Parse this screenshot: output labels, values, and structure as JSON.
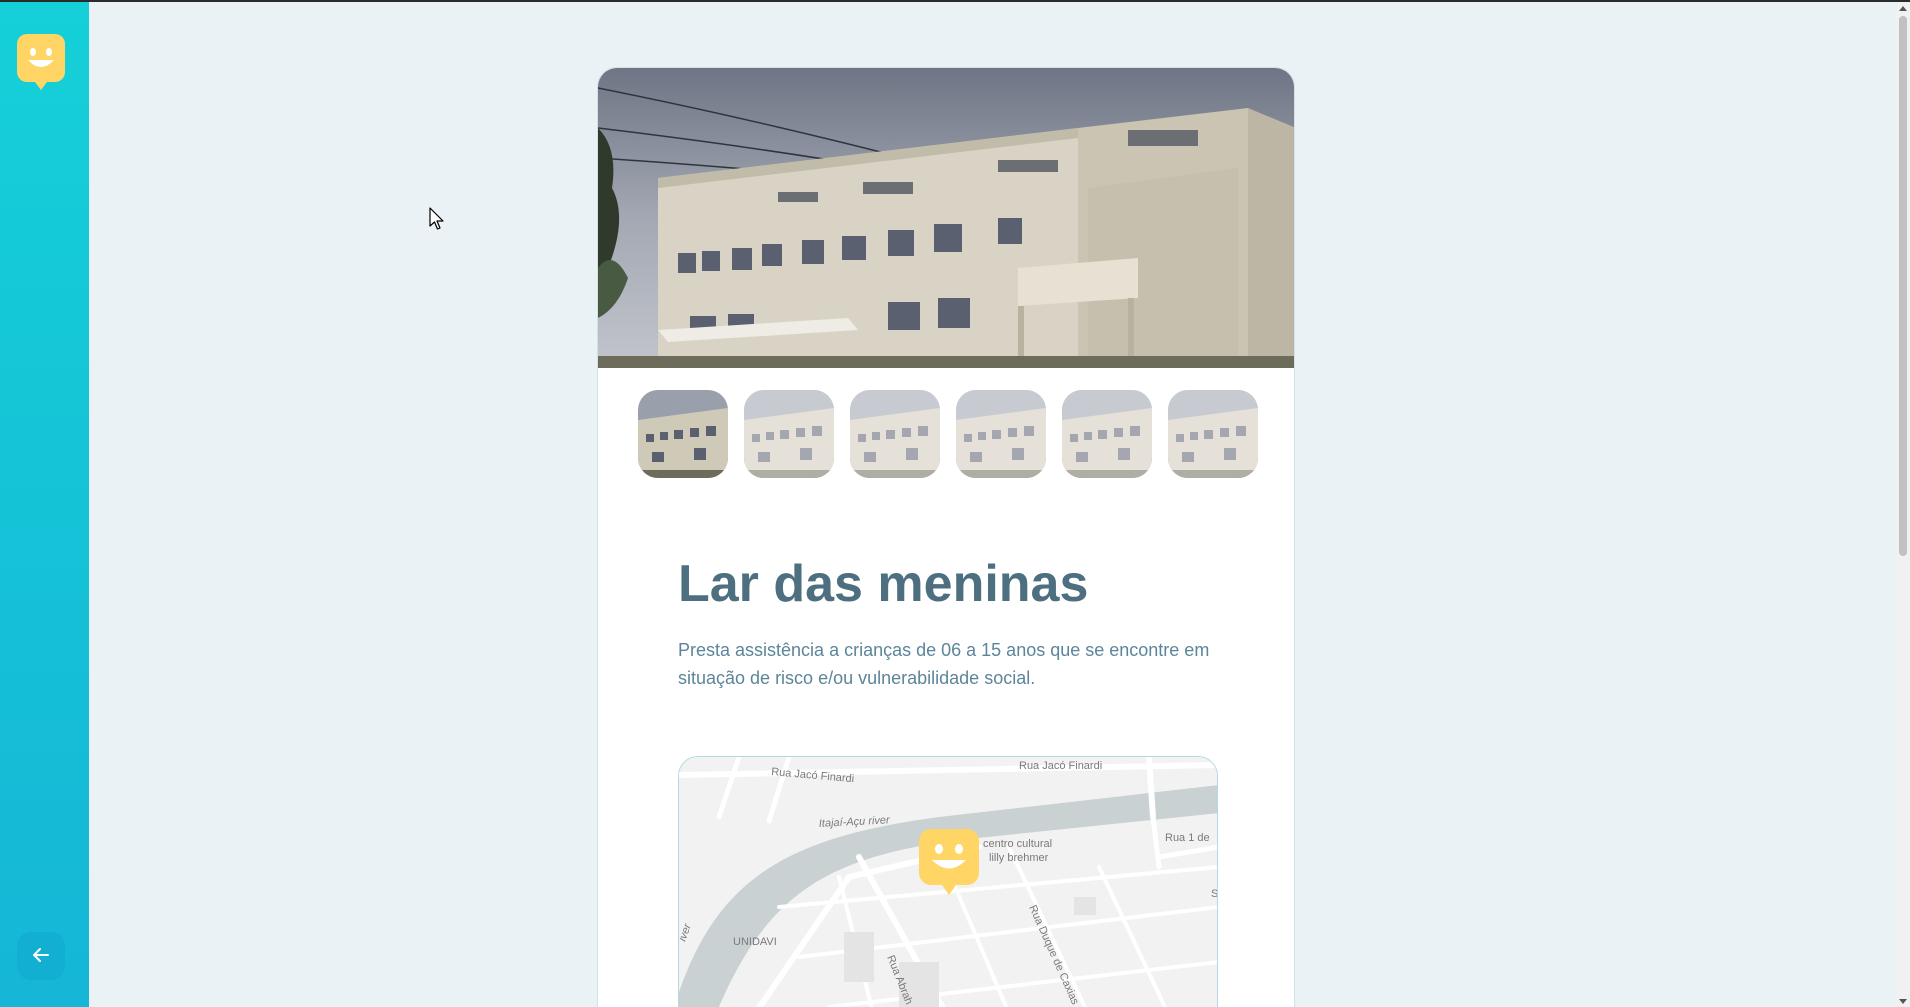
{
  "app": {
    "accent": "#15c3d6",
    "marker_color": "#ffd666",
    "title_color": "#4d6f80"
  },
  "sidebar": {
    "logo_icon": "happy-face-logo-icon",
    "back_button_icon": "arrow-left-icon"
  },
  "orphanage": {
    "name": "Lar das meninas",
    "about": "Presta assistência a crianças de 06 a 15 anos que se encontre em situação de risco e/ou vulnerabilidade social."
  },
  "gallery": {
    "image_count": 6,
    "active_index": 0
  },
  "map": {
    "labels": {
      "street_1": "Rua Jacó Finardi",
      "street_2": "Rua Jacó Finardi",
      "river": "Itajaí-Açu river",
      "river_2": "iver",
      "poi_line1": "centro cultural",
      "poi_line2": "lilly brehmer",
      "street_3": "Rua 1 de",
      "unidavi": "UNIDAVI",
      "street_4": "Rua Duque de Caxias",
      "street_5": "Rua Abrah",
      "edge_s": "S",
      "edge_r": "R"
    }
  }
}
